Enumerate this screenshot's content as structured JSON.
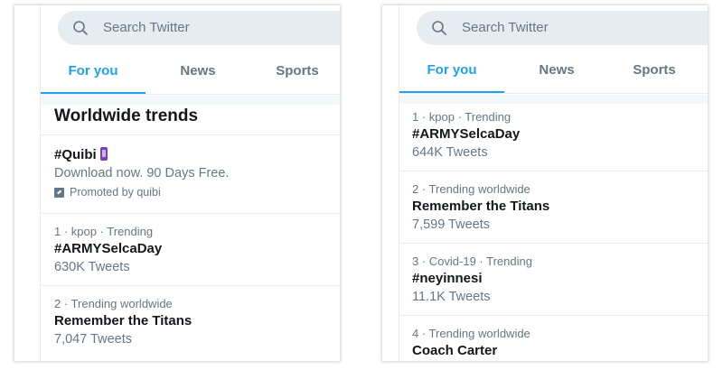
{
  "left_panel": {
    "search_placeholder": "Search Twitter",
    "tabs": [
      {
        "label": "For you",
        "active": true
      },
      {
        "label": "News",
        "active": false
      },
      {
        "label": "Sports",
        "active": false
      }
    ],
    "section_title": "Worldwide trends",
    "promoted": {
      "name": "#Quibi",
      "emoji_icon": "mobile-phone-icon",
      "description": "Download now. 90 Days Free.",
      "promoted_label": "Promoted by quibi"
    },
    "trends": [
      {
        "meta": "1 · kpop · Trending",
        "name": "#ARMYSelcaDay",
        "count": "630K Tweets"
      },
      {
        "meta": "2 · Trending worldwide",
        "name": "Remember the Titans",
        "count": "7,047 Tweets"
      }
    ]
  },
  "right_panel": {
    "search_placeholder": "Search Twitter",
    "tabs": [
      {
        "label": "For you",
        "active": true
      },
      {
        "label": "News",
        "active": false
      },
      {
        "label": "Sports",
        "active": false
      }
    ],
    "trends": [
      {
        "meta": "1 · kpop · Trending",
        "name": "#ARMYSelcaDay",
        "count": "644K Tweets"
      },
      {
        "meta": "2 · Trending worldwide",
        "name": "Remember the Titans",
        "count": "7,599 Tweets"
      },
      {
        "meta": "3 · Covid-19 · Trending",
        "name": "#neyinnesi",
        "count": "11.1K Tweets"
      },
      {
        "meta": "4 · Trending worldwide",
        "name": "Coach Carter",
        "count": ""
      }
    ]
  },
  "colors": {
    "accent": "#1da1f2",
    "secondary_text": "#657786",
    "primary_text": "#14171a",
    "border": "#e6ecf0",
    "search_bg": "#e6ecf0"
  }
}
